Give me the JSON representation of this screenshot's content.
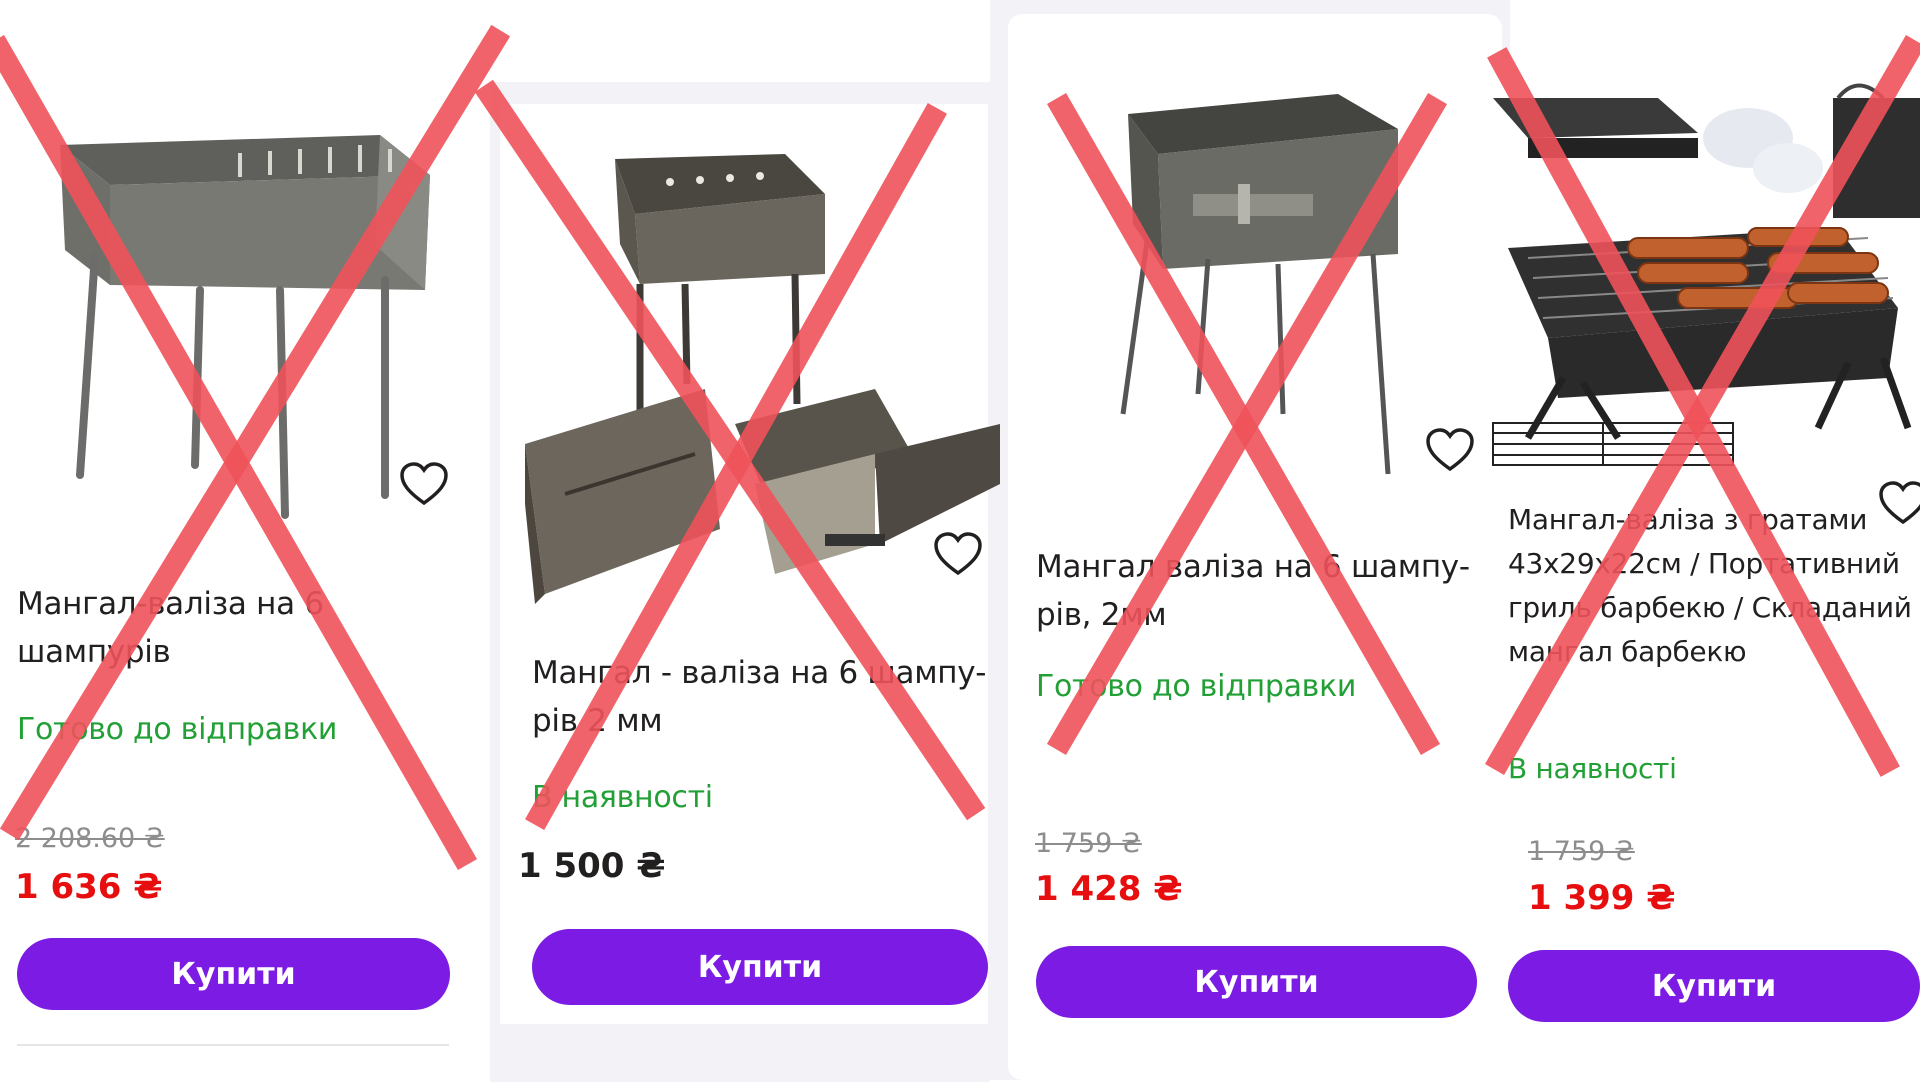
{
  "products": [
    {
      "title": "Мангал-валіза на 6 шампурів",
      "status": "Готово до відправки",
      "old_price": "2 208.60 ₴",
      "price": "1 636 ₴",
      "buy_label": "Купити"
    },
    {
      "title_line1": "Мангал - валіза на 6 шампу-",
      "title_line2": "рів 2 мм",
      "status": "В наявності",
      "price": "1 500 ₴",
      "buy_label": "Купити"
    },
    {
      "title_line1": "Мангал валіза на 6 шампу-",
      "title_line2": "рів, 2мм",
      "status": "Готово до відправки",
      "old_price": "1 759 ₴",
      "price": "1 428 ₴",
      "buy_label": "Купити"
    },
    {
      "title_line1": "Мангал-валіза з гратами",
      "title_line2": "43х29х22см / Портативний",
      "title_line3": "гриль барбекю / Складаний",
      "title_line4": "мангал барбекю",
      "status": "В наявності",
      "old_price": "1 759 ₴",
      "price": "1 399 ₴",
      "buy_label": "Купити"
    }
  ],
  "colors": {
    "buy_button": "#7b1be3",
    "in_stock": "#22a036",
    "sale_price": "#e60e0e",
    "cross_overlay": "#f0525a"
  },
  "icons": [
    "heart-icon",
    "cross-out-mark"
  ]
}
